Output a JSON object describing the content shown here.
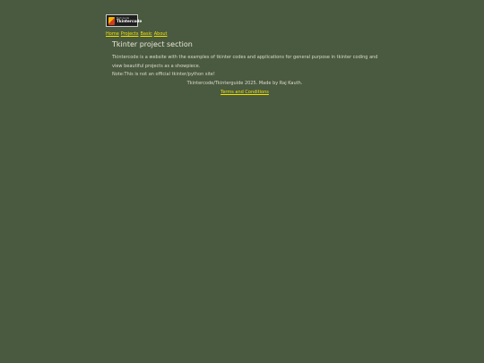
{
  "logo": {
    "small_text": "Tech Guide",
    "big_text": "Tkintercode",
    "colors": {
      "mark_top": "#f4b000",
      "mark_bottom": "#d23b1f",
      "background": "#1f1f1f"
    }
  },
  "nav": {
    "items": [
      {
        "label": "Home"
      },
      {
        "label": "Projects"
      },
      {
        "label": "Basic"
      },
      {
        "label": "About"
      }
    ],
    "link_color": "#f0e000"
  },
  "main": {
    "title": "Tkinter project section",
    "description": "Tkintercode is a website with the examples of tkinter codes and applications for general purpose in tkinter coding and view beautiful projects as a showpiece.",
    "note": "Note:This is not an official tkinter/python site!"
  },
  "footer": {
    "credit": "Tkintercode/Tkinterguide 2025. Made by Raj Kauth.",
    "terms_label": "Terms and Conditions"
  },
  "colors": {
    "page_background": "#4a5a40",
    "text": "#e8e6d8"
  }
}
